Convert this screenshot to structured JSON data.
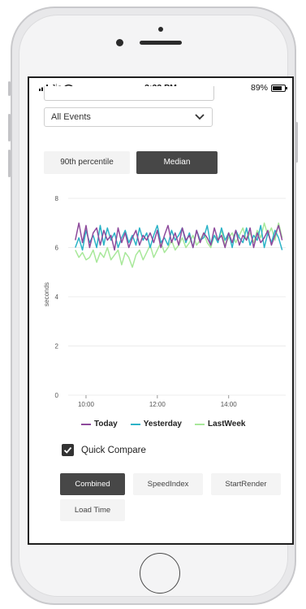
{
  "status_bar": {
    "carrier": "Jio",
    "time": "3:33 PM",
    "battery": "89%",
    "battery_level": 0.89
  },
  "filter": {
    "selected": "All Events"
  },
  "metric_tabs": {
    "percentile_label": "90th percentile",
    "median_label": "Median",
    "active": "Median"
  },
  "chart_data": {
    "type": "line",
    "ylabel": "seconds",
    "xlabel": "",
    "ylim": [
      0,
      8
    ],
    "y_ticks": [
      "0",
      "2",
      "4",
      "6",
      "8"
    ],
    "x_range": [
      9.5,
      15.6
    ],
    "x_ticks": [
      {
        "value": 10,
        "label": "10:00"
      },
      {
        "value": 12,
        "label": "12:00"
      },
      {
        "value": 14,
        "label": "14:00"
      }
    ],
    "grid": true,
    "legend": "bottom",
    "x": [
      9.7,
      9.8,
      9.9,
      10,
      10.1,
      10.2,
      10.3,
      10.4,
      10.5,
      10.6,
      10.7,
      10.8,
      10.9,
      11,
      11.1,
      11.2,
      11.3,
      11.4,
      11.5,
      11.6,
      11.7,
      11.8,
      11.9,
      12,
      12.1,
      12.2,
      12.3,
      12.4,
      12.5,
      12.6,
      12.7,
      12.8,
      12.9,
      13,
      13.1,
      13.2,
      13.3,
      13.4,
      13.5,
      13.6,
      13.7,
      13.8,
      13.9,
      14,
      14.1,
      14.2,
      14.3,
      14.4,
      14.5,
      14.6,
      14.7,
      14.8,
      14.9,
      15,
      15.1,
      15.2,
      15.3,
      15.4,
      15.5
    ],
    "series": [
      {
        "name": "Today",
        "color": "#8e4a9c",
        "values": [
          6.3,
          7.0,
          6.2,
          6.9,
          6.0,
          6.6,
          6.8,
          6.1,
          6.7,
          6.3,
          6.5,
          5.9,
          6.8,
          6.2,
          6.6,
          6.0,
          6.4,
          6.7,
          6.1,
          6.5,
          6.3,
          6.6,
          6.2,
          6.7,
          6.0,
          6.5,
          6.9,
          6.2,
          6.6,
          6.1,
          6.8,
          6.3,
          6.5,
          6.0,
          6.7,
          6.2,
          6.6,
          6.4,
          6.1,
          6.8,
          6.3,
          6.5,
          6.0,
          6.6,
          6.2,
          6.7,
          6.1,
          6.5,
          6.3,
          6.8,
          6.0,
          6.6,
          6.2,
          6.4,
          6.7,
          6.1,
          6.5,
          6.9,
          6.3
        ]
      },
      {
        "name": "Yesterday",
        "color": "#2bb3c7",
        "values": [
          6.0,
          6.4,
          5.9,
          6.7,
          6.2,
          6.5,
          6.0,
          6.9,
          6.1,
          6.8,
          6.3,
          6.6,
          6.0,
          6.4,
          6.7,
          6.2,
          6.5,
          6.1,
          6.8,
          6.3,
          6.6,
          6.0,
          6.5,
          6.9,
          6.2,
          6.4,
          6.1,
          6.7,
          6.3,
          6.5,
          6.8,
          6.2,
          6.6,
          6.0,
          6.7,
          6.3,
          6.4,
          6.9,
          6.1,
          6.5,
          6.2,
          6.8,
          6.3,
          6.6,
          6.0,
          6.7,
          6.4,
          6.2,
          6.8,
          6.1,
          6.5,
          6.3,
          6.9,
          6.0,
          6.6,
          6.2,
          6.7,
          6.4,
          5.9
        ]
      },
      {
        "name": "LastWeek",
        "color": "#a8e89a",
        "values": [
          5.9,
          5.6,
          5.8,
          5.5,
          5.6,
          5.9,
          5.4,
          5.8,
          5.6,
          6.0,
          5.5,
          5.7,
          5.9,
          5.3,
          5.8,
          5.6,
          5.2,
          5.7,
          5.9,
          5.5,
          5.8,
          6.1,
          5.6,
          5.9,
          6.2,
          5.8,
          6.0,
          6.3,
          5.9,
          6.1,
          6.4,
          6.0,
          6.2,
          6.5,
          6.1,
          6.3,
          6.6,
          6.2,
          6.0,
          6.5,
          6.3,
          6.7,
          6.1,
          6.4,
          6.6,
          6.2,
          6.5,
          6.8,
          6.3,
          6.6,
          6.2,
          6.7,
          6.4,
          7.0,
          6.5,
          6.8,
          6.3,
          7.0,
          6.4
        ]
      }
    ]
  },
  "quick_compare": {
    "label": "Quick Compare",
    "checked": true
  },
  "compare_options": [
    "Combined",
    "SpeedIndex",
    "StartRender",
    "Load Time"
  ],
  "compare_active": "Combined"
}
